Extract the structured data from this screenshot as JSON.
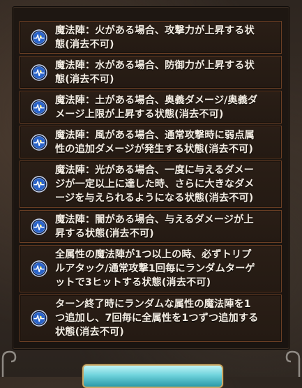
{
  "status_list": {
    "items": [
      {
        "lines": [
          "魔法陣：火がある場合、攻撃力が上昇する状",
          "態(消去不可)"
        ],
        "icon": "magic-circle-icon"
      },
      {
        "lines": [
          "魔法陣：水がある場合、防御力が上昇する状",
          "態(消去不可)"
        ],
        "icon": "magic-circle-icon"
      },
      {
        "lines": [
          "魔法陣：土がある場合、奥義ダメージ/奥義ダ",
          "メージ上限が上昇する状態(消去不可)"
        ],
        "icon": "magic-circle-icon"
      },
      {
        "lines": [
          "魔法陣：風がある場合、通常攻撃時に弱点属",
          "性の追加ダメージが発生する状態(消去不可)"
        ],
        "icon": "magic-circle-icon"
      },
      {
        "lines": [
          "魔法陣：光がある場合、一度に与えるダメー",
          "ジが一定以上に達した時、さらに大きなダメ",
          "ージを与えられるようになる状態(消去不可)"
        ],
        "icon": "magic-circle-icon"
      },
      {
        "lines": [
          "魔法陣：闇がある場合、与えるダメージが上",
          "昇する状態(消去不可)"
        ],
        "icon": "magic-circle-icon"
      },
      {
        "lines": [
          "全属性の魔法陣が1つ以上の時、必ずトリプ",
          "ルアタック/通常攻撃1回毎にランダムターゲ",
          "ットで3ヒットする状態(消去不可)"
        ],
        "icon": "magic-circle-icon"
      },
      {
        "lines": [
          "ターン終了時にランダムな属性の魔法陣を1",
          "つ追加し、7回毎に全属性を1つずつ追加する",
          "状態(消去不可)"
        ],
        "icon": "magic-circle-icon"
      }
    ]
  },
  "colors": {
    "item_border": "#6b3f24",
    "text": "#f3ece2",
    "icon_blue": "#2a63c9"
  }
}
